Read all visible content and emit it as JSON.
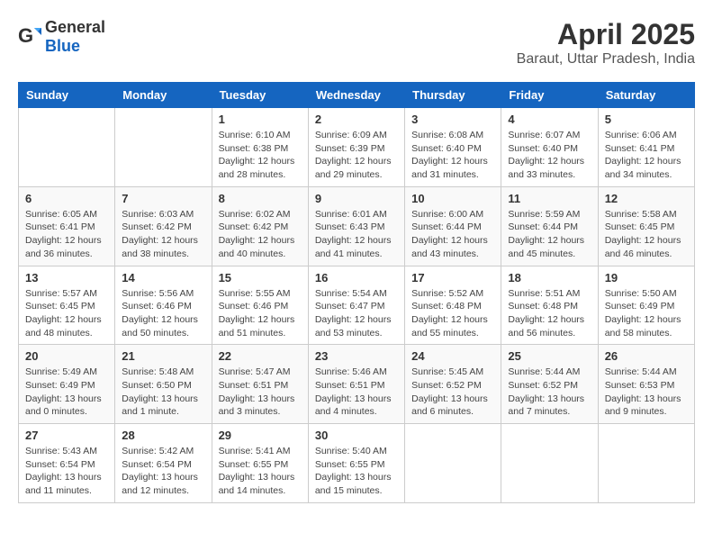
{
  "header": {
    "logo_general": "General",
    "logo_blue": "Blue",
    "title": "April 2025",
    "subtitle": "Baraut, Uttar Pradesh, India"
  },
  "calendar": {
    "days_of_week": [
      "Sunday",
      "Monday",
      "Tuesday",
      "Wednesday",
      "Thursday",
      "Friday",
      "Saturday"
    ],
    "weeks": [
      [
        {
          "day": "",
          "info": ""
        },
        {
          "day": "",
          "info": ""
        },
        {
          "day": "1",
          "info": "Sunrise: 6:10 AM\nSunset: 6:38 PM\nDaylight: 12 hours and 28 minutes."
        },
        {
          "day": "2",
          "info": "Sunrise: 6:09 AM\nSunset: 6:39 PM\nDaylight: 12 hours and 29 minutes."
        },
        {
          "day": "3",
          "info": "Sunrise: 6:08 AM\nSunset: 6:40 PM\nDaylight: 12 hours and 31 minutes."
        },
        {
          "day": "4",
          "info": "Sunrise: 6:07 AM\nSunset: 6:40 PM\nDaylight: 12 hours and 33 minutes."
        },
        {
          "day": "5",
          "info": "Sunrise: 6:06 AM\nSunset: 6:41 PM\nDaylight: 12 hours and 34 minutes."
        }
      ],
      [
        {
          "day": "6",
          "info": "Sunrise: 6:05 AM\nSunset: 6:41 PM\nDaylight: 12 hours and 36 minutes."
        },
        {
          "day": "7",
          "info": "Sunrise: 6:03 AM\nSunset: 6:42 PM\nDaylight: 12 hours and 38 minutes."
        },
        {
          "day": "8",
          "info": "Sunrise: 6:02 AM\nSunset: 6:42 PM\nDaylight: 12 hours and 40 minutes."
        },
        {
          "day": "9",
          "info": "Sunrise: 6:01 AM\nSunset: 6:43 PM\nDaylight: 12 hours and 41 minutes."
        },
        {
          "day": "10",
          "info": "Sunrise: 6:00 AM\nSunset: 6:44 PM\nDaylight: 12 hours and 43 minutes."
        },
        {
          "day": "11",
          "info": "Sunrise: 5:59 AM\nSunset: 6:44 PM\nDaylight: 12 hours and 45 minutes."
        },
        {
          "day": "12",
          "info": "Sunrise: 5:58 AM\nSunset: 6:45 PM\nDaylight: 12 hours and 46 minutes."
        }
      ],
      [
        {
          "day": "13",
          "info": "Sunrise: 5:57 AM\nSunset: 6:45 PM\nDaylight: 12 hours and 48 minutes."
        },
        {
          "day": "14",
          "info": "Sunrise: 5:56 AM\nSunset: 6:46 PM\nDaylight: 12 hours and 50 minutes."
        },
        {
          "day": "15",
          "info": "Sunrise: 5:55 AM\nSunset: 6:46 PM\nDaylight: 12 hours and 51 minutes."
        },
        {
          "day": "16",
          "info": "Sunrise: 5:54 AM\nSunset: 6:47 PM\nDaylight: 12 hours and 53 minutes."
        },
        {
          "day": "17",
          "info": "Sunrise: 5:52 AM\nSunset: 6:48 PM\nDaylight: 12 hours and 55 minutes."
        },
        {
          "day": "18",
          "info": "Sunrise: 5:51 AM\nSunset: 6:48 PM\nDaylight: 12 hours and 56 minutes."
        },
        {
          "day": "19",
          "info": "Sunrise: 5:50 AM\nSunset: 6:49 PM\nDaylight: 12 hours and 58 minutes."
        }
      ],
      [
        {
          "day": "20",
          "info": "Sunrise: 5:49 AM\nSunset: 6:49 PM\nDaylight: 13 hours and 0 minutes."
        },
        {
          "day": "21",
          "info": "Sunrise: 5:48 AM\nSunset: 6:50 PM\nDaylight: 13 hours and 1 minute."
        },
        {
          "day": "22",
          "info": "Sunrise: 5:47 AM\nSunset: 6:51 PM\nDaylight: 13 hours and 3 minutes."
        },
        {
          "day": "23",
          "info": "Sunrise: 5:46 AM\nSunset: 6:51 PM\nDaylight: 13 hours and 4 minutes."
        },
        {
          "day": "24",
          "info": "Sunrise: 5:45 AM\nSunset: 6:52 PM\nDaylight: 13 hours and 6 minutes."
        },
        {
          "day": "25",
          "info": "Sunrise: 5:44 AM\nSunset: 6:52 PM\nDaylight: 13 hours and 7 minutes."
        },
        {
          "day": "26",
          "info": "Sunrise: 5:44 AM\nSunset: 6:53 PM\nDaylight: 13 hours and 9 minutes."
        }
      ],
      [
        {
          "day": "27",
          "info": "Sunrise: 5:43 AM\nSunset: 6:54 PM\nDaylight: 13 hours and 11 minutes."
        },
        {
          "day": "28",
          "info": "Sunrise: 5:42 AM\nSunset: 6:54 PM\nDaylight: 13 hours and 12 minutes."
        },
        {
          "day": "29",
          "info": "Sunrise: 5:41 AM\nSunset: 6:55 PM\nDaylight: 13 hours and 14 minutes."
        },
        {
          "day": "30",
          "info": "Sunrise: 5:40 AM\nSunset: 6:55 PM\nDaylight: 13 hours and 15 minutes."
        },
        {
          "day": "",
          "info": ""
        },
        {
          "day": "",
          "info": ""
        },
        {
          "day": "",
          "info": ""
        }
      ]
    ]
  }
}
